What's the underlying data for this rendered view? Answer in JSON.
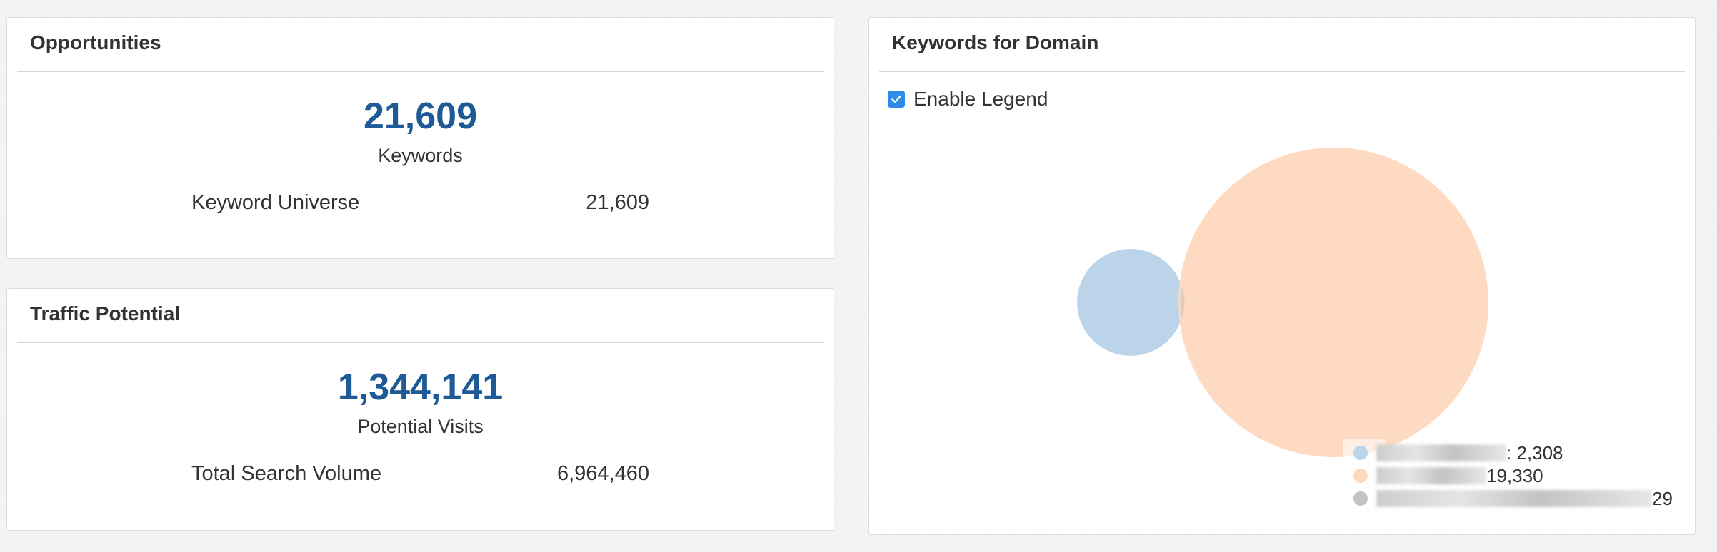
{
  "opportunities": {
    "title": "Opportunities",
    "big_number": "21,609",
    "big_caption": "Keywords",
    "stat_label": "Keyword Universe",
    "stat_value": "21,609"
  },
  "traffic": {
    "title": "Traffic Potential",
    "big_number": "1,344,141",
    "big_caption": "Potential Visits",
    "stat_label": "Total Search Volume",
    "stat_value": "6,964,460"
  },
  "keywords_for_domain": {
    "title": "Keywords for Domain",
    "enable_legend_label": "Enable Legend",
    "enable_legend_checked": true,
    "legend": [
      {
        "value": ": 2,308",
        "color": "#bcd4ea"
      },
      {
        "value": " 19,330",
        "color": "#fdd9bf"
      },
      {
        "value": " 29",
        "color": "#c4c4c4"
      }
    ]
  },
  "icons": {
    "checkbox": "check-icon"
  }
}
